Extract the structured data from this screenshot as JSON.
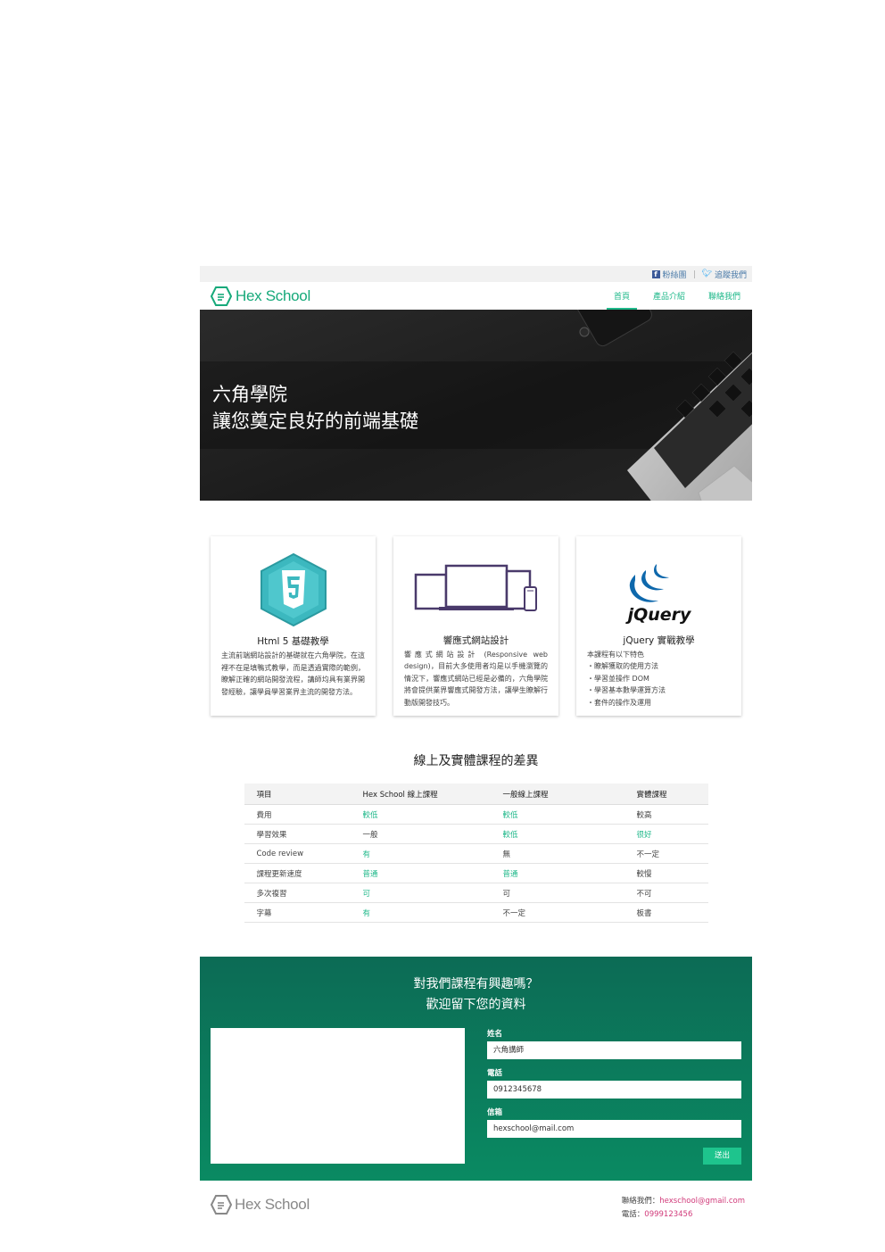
{
  "topbar": {
    "fans": "粉絲團",
    "follow": "追蹤我們"
  },
  "brand": {
    "name": "Hex School",
    "color": "#16a97a"
  },
  "nav": {
    "items": [
      "首頁",
      "產品介紹",
      "聯絡我們"
    ],
    "active": 0
  },
  "hero": {
    "line1": "六角學院",
    "line2": "讓您奠定良好的前端基礎"
  },
  "features": [
    {
      "icon": "html5-icon",
      "title": "Html 5 基礎教學",
      "text": "主流前端網站設計的基礎就在六角學院，在這裡不在是填鴨式教學，而是透過實際的範例，瞭解正確的網站開發流程，講師均具有業界開發經驗，讓學員學習業界主流的開發方法。"
    },
    {
      "icon": "responsive-devices-icon",
      "title": "響應式網站設計",
      "text": "響應式網站設計 (Responsive web design)，目前大多使用者均是以手機瀏覽的情況下，響應式網站已經是必備的，六角學院將會提供業界響應式開發方法，讓學生瞭解行動版開發技巧。"
    },
    {
      "icon": "jquery-icon",
      "title": "jQuery 實戰教學",
      "list": [
        "本課程有以下特色",
        "・瞭解獲取的使用方法",
        "・學習並操作 DOM",
        "・學習基本數學運算方法",
        "・套件的操作及運用"
      ]
    }
  ],
  "comparison": {
    "title": "線上及實體課程的差異",
    "headers": [
      "項目",
      "Hex School 線上課程",
      "一般線上課程",
      "實體課程"
    ],
    "rows": [
      [
        "費用",
        "較低",
        "較低",
        "較高"
      ],
      [
        "學習效果",
        "一般",
        "較低",
        "很好"
      ],
      [
        "Code review",
        "有",
        "無",
        "不一定"
      ],
      [
        "課程更新速度",
        "普通",
        "普通",
        "較慢"
      ],
      [
        "多次複習",
        "可",
        "可",
        "不可"
      ],
      [
        "字幕",
        "有",
        "不一定",
        "板書"
      ]
    ],
    "highlight": [
      [
        false,
        true,
        true,
        false
      ],
      [
        false,
        false,
        true,
        true
      ],
      [
        false,
        true,
        false,
        false
      ],
      [
        false,
        true,
        true,
        false
      ],
      [
        false,
        true,
        false,
        false
      ],
      [
        false,
        true,
        false,
        false
      ]
    ]
  },
  "contact": {
    "heading1": "對我們課程有興趣嗎？",
    "heading2": "歡迎留下您的資料",
    "name_label": "姓名",
    "name_value": "六角講師",
    "phone_label": "電話",
    "phone_value": "0912345678",
    "email_label": "信箱",
    "email_value": "hexschool@mail.com",
    "submit": "送出"
  },
  "footer": {
    "contact_label": "聯絡我們：",
    "email": "hexschool@gmail.com",
    "phone_label": "電話：",
    "phone": "0999123456"
  }
}
